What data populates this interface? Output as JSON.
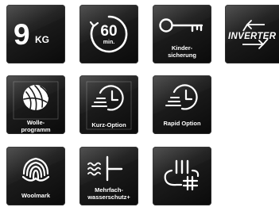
{
  "tiles": {
    "capacity": {
      "number": "9",
      "unit": "KG",
      "icon": "capacity-9kg-icon"
    },
    "sixty_min": {
      "number": "60",
      "unit": "min.",
      "icon": "timer-60-min-icon"
    },
    "child_lock": {
      "label_line1": "Kinder-",
      "label_line2": "sicherung",
      "icon": "key-icon"
    },
    "inverter": {
      "label": "INVERTER",
      "icon": "inverter-arrows-icon"
    },
    "wool": {
      "label_line1": "Wolle-",
      "label_line2": "programm",
      "icon": "wool-ball-icon"
    },
    "kurz": {
      "label": "Kurz-Option",
      "icon": "quick-clock-icon"
    },
    "rapid": {
      "label": "Rapid Option",
      "icon": "rapid-clock-icon"
    },
    "woolmark": {
      "label": "Woolmark",
      "icon": "woolmark-logo-icon"
    },
    "water_protect": {
      "label_line1": "Mehrfach-",
      "label_line2": "wasserschutz+",
      "icon": "water-protection-icon"
    },
    "steam": {
      "icon": "steam-plus-icon"
    }
  },
  "colors": {
    "tile_dark": "#0a0a0a",
    "tile_light": "#3e3e3e",
    "icon": "#ffffff"
  }
}
